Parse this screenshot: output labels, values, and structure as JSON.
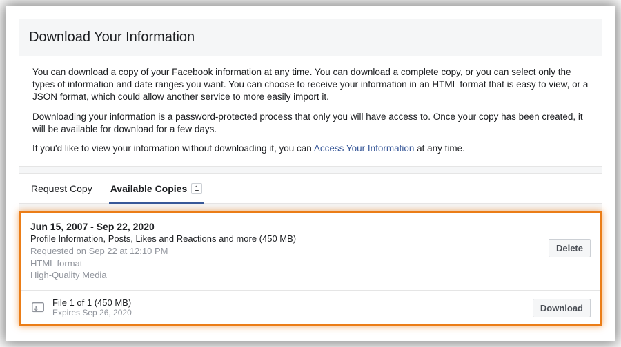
{
  "header": {
    "title": "Download Your Information"
  },
  "intro": {
    "p1": "You can download a copy of your Facebook information at any time. You can download a complete copy, or you can select only the types of information and date ranges you want. You can choose to receive your information in an HTML format that is easy to view, or a JSON format, which could allow another service to more easily import it.",
    "p2": "Downloading your information is a password-protected process that only you will have access to. Once your copy has been created, it will be available for download for a few days.",
    "p3_pre": "If you'd like to view your information without downloading it, you can ",
    "p3_link": "Access Your Information",
    "p3_post": " at any time."
  },
  "tabs": {
    "request": "Request Copy",
    "available": "Available Copies",
    "count": "1"
  },
  "copy": {
    "date_range": "Jun 15, 2007 - Sep 22, 2020",
    "description": "Profile Information, Posts, Likes and Reactions and more (450 MB)",
    "requested": "Requested on Sep 22 at 12:10 PM",
    "format": "HTML format",
    "quality": "High-Quality Media",
    "delete_label": "Delete"
  },
  "file": {
    "title": "File 1 of 1 (450 MB)",
    "expires": "Expires Sep 26, 2020",
    "download_label": "Download"
  }
}
